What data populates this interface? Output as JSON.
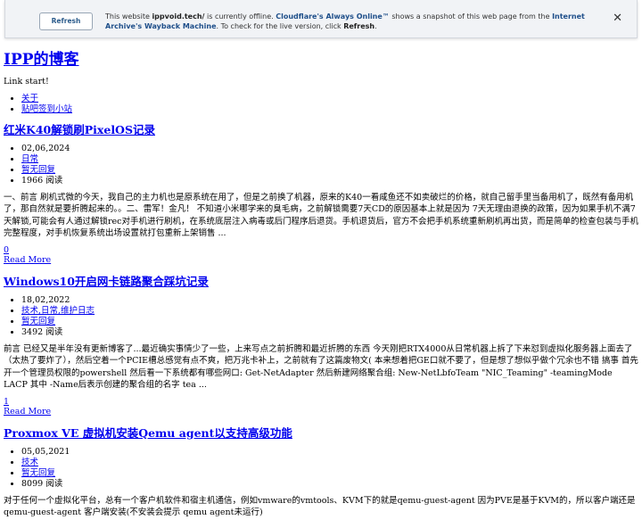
{
  "banner": {
    "refresh_label": "Refresh",
    "msg_pre": "This website ",
    "site": "ippvoid.tech/",
    "msg_mid": " is currently offline. ",
    "cf_link": "Cloudflare's Always Online™",
    "msg_mid2": " shows a snapshot of this web page from the ",
    "archive_link": "Internet Archive's Wayback Machine",
    "msg_post": ". To check for the live version, click ",
    "msg_refresh": "Refresh",
    "msg_end": "."
  },
  "site": {
    "title": "IPP的博客",
    "tagline": "Link start!",
    "nav": [
      "关于",
      "贴吧签到小站"
    ]
  },
  "posts": [
    {
      "title": "红米K40解锁刷PixelOS记录",
      "date": "02,06,2024",
      "category": "日常",
      "comments": "暂无回复",
      "reads": "1966 阅读",
      "excerpt": "一、前言 刷机式微的今天，我自己的主力机也是原系统在用了，但是之前换了机器，原来的K40一看咸鱼还不如卖破烂的价格，就自己留手里当备用机了，既然有备用机了，那自然就是要折腾起来的。。二、雷军！金凡！ 不知道小米哪学来的臭毛病，之前解锁需要7天CD的原因基本上就是因为 7天无理由退换的政策，因为如果手机不满7天解锁,可能会有人通过解锁rec对手机进行刷机，在系统底层注入病毒或后门程序后退货。手机退货后，官方不会把手机系统重新刷机再出货，而是简单的检查包装与手机完整程度，对手机恢复系统出场设置就打包重新上架销售 ...",
      "count": "0",
      "read_more": "Read More"
    },
    {
      "title": "Windows10开启网卡链路聚合踩坑记录",
      "date": "18,02,2022",
      "category": "技术,日常,维护日志",
      "comments": "暂无回复",
      "reads": "3492 阅读",
      "excerpt": "前言 已经又是半年没有更新博客了...最近确实事情少了一些，上来写点之前折腾和最近折腾的东西 今天刚把RTX4000从日常机器上拆了下来怼到虚拟化服务器上面去了（太热了要炸了），然后空着一个PCIE槽总感觉有点不爽，把万兆卡补上，之前就有了这篇废物文( 本来想着把GE口就不要了，但是想了想似乎做个冗余也不错   搞事 首先开一个管理员权限的powershell 然后看一下系统都有哪些网口: Get-NetAdapter 然后新建网络聚合组: New-NetLbfoTeam \"NIC_Teaming\" -teamingMode LACP 其中 -Name后表示创建的聚合组的名字 tea ...",
      "count": "1",
      "read_more": "Read More"
    },
    {
      "title": "Proxmox VE 虚拟机安装Qemu agent以支持高级功能",
      "date": "05,05,2021",
      "category": "技术",
      "comments": "暂无回复",
      "reads": "8099 阅读",
      "excerpt": "对于任何一个虚拟化平台，总有一个客户机软件和宿主机通信，例如vmware的vmtools、KVM下的就是qemu-guest-agent 因为PVE是基于KVM的，所以客户端还是 qemu-guest-agent 客户端安装(不安装会提示 qemu agent未运行)"
    }
  ]
}
